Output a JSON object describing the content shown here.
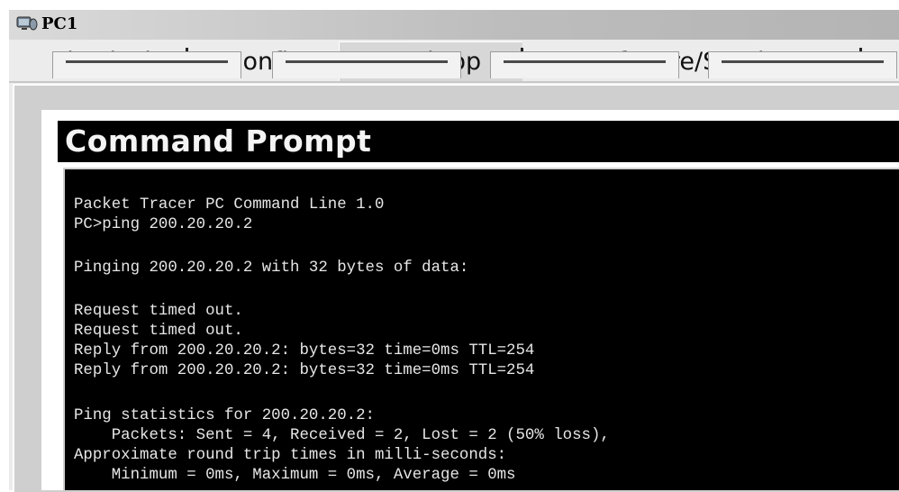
{
  "window": {
    "title": "PC1",
    "icon": "pc-device-icon"
  },
  "tabs": [
    {
      "label": "Physical",
      "active": false
    },
    {
      "label": "Config",
      "active": false
    },
    {
      "label": "Desktop",
      "active": true
    },
    {
      "label": "Software/Services",
      "active": false
    }
  ],
  "desktop_apps": [
    "app-tile-1",
    "app-tile-2",
    "app-tile-3",
    "app-tile-4"
  ],
  "command_prompt": {
    "title": "Command Prompt",
    "lines": [
      "Packet Tracer PC Command Line 1.0",
      "PC>ping 200.20.20.2",
      "Pinging 200.20.20.2 with 32 bytes of data:",
      "Request timed out.",
      "Request timed out.",
      "Reply from 200.20.20.2: bytes=32 time=0ms TTL=254",
      "Reply from 200.20.20.2: bytes=32 time=0ms TTL=254",
      "Ping statistics for 200.20.20.2:",
      "    Packets: Sent = 4, Received = 2, Lost = 2 (50% loss),",
      "Approximate round trip times in milli-seconds:",
      "    Minimum = 0ms, Maximum = 0ms, Average = 0ms"
    ]
  },
  "colors": {
    "terminal_bg": "#000000",
    "terminal_text": "#e6e6e6",
    "header_bg": "#000000"
  }
}
